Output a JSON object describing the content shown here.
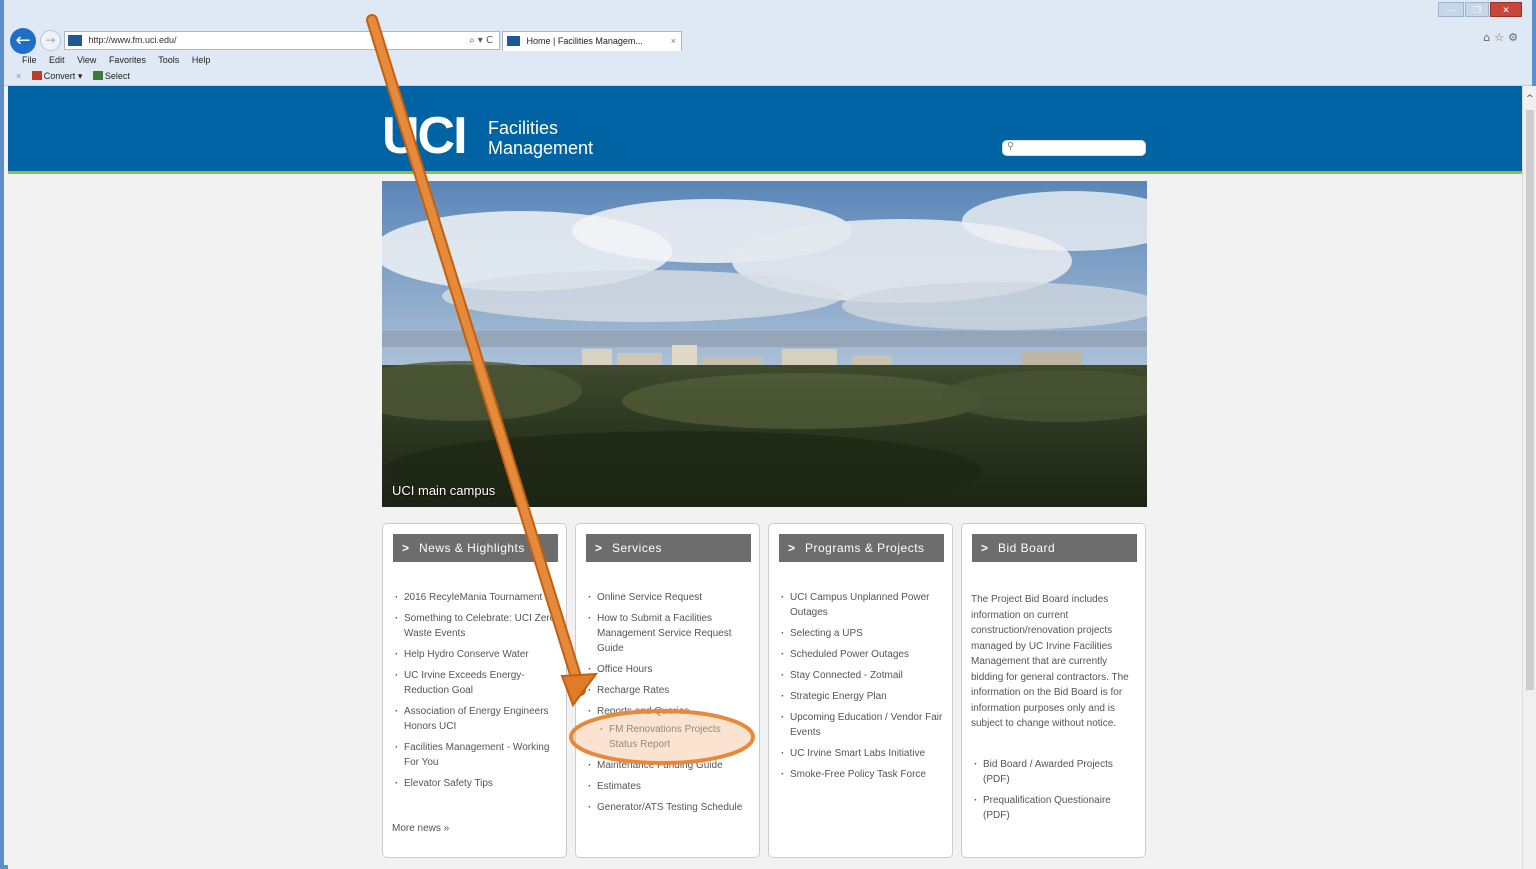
{
  "browser": {
    "url": "http://www.fm.uci.edu/",
    "url_controls": "⌕ ▾ C",
    "tab_title": "Home | Facilities Managem...",
    "tab_close": "×",
    "back_glyph": "←",
    "forward_glyph": "→",
    "menu": [
      "File",
      "Edit",
      "View",
      "Favorites",
      "Tools",
      "Help"
    ],
    "command_bar": {
      "close": "×",
      "convert": "Convert",
      "convert_arrow": "▾",
      "select": "Select"
    },
    "window_controls": {
      "minimize": "—",
      "maximize": "❐",
      "close": "✕"
    },
    "right_icons": "⌂☆⚙"
  },
  "site": {
    "logo_mark": "UCI",
    "logo_line1": "Facilities",
    "logo_line2": "Management",
    "search_glyph": "⚲",
    "hero_caption": "UCI main campus",
    "columns": [
      {
        "header": "News & Highlights",
        "items": [
          "2016 RecyleMania Tournament",
          "Something to Celebrate: UCI Zero Waste Events",
          "Help Hydro Conserve Water",
          "UC Irvine Exceeds Energy-Reduction Goal",
          "Association of Energy Engineers Honors UCI",
          "Facilities Management - Working For You",
          "Elevator Safety Tips"
        ],
        "more": "More news »"
      },
      {
        "header": "Services",
        "items": [
          "Online Service Request",
          "How to Submit a Facilities Management Service Request Guide",
          "Office Hours",
          "Recharge Rates",
          "Reports and Queries"
        ],
        "subitem": "FM Renovations Projects Status Report",
        "items_after": [
          "Maintenance Funding Guide",
          "Estimates",
          "Generator/ATS Testing Schedule"
        ]
      },
      {
        "header": "Programs & Projects",
        "items": [
          "UCI Campus Unplanned Power Outages",
          "Selecting a UPS",
          "Scheduled Power Outages",
          "Stay Connected - Zotmail",
          "Strategic Energy Plan",
          "Upcoming Education / Vendor Fair Events",
          "UC Irvine Smart Labs Initiative",
          "Smoke-Free Policy Task Force"
        ]
      },
      {
        "header": "Bid Board",
        "text": "The Project Bid Board includes information on current construction/renovation projects managed by UC Irvine Facilities Management that are currently bidding for general contractors. The information on the Bid Board is for information purposes only and is subject to change without notice.",
        "items": [
          "Bid Board / Awarded Projects (PDF)",
          "Prequalification Questionaire (PDF)"
        ]
      }
    ]
  },
  "colors": {
    "banner": "#0064a4",
    "accent_stripe": "#8dbc47",
    "column_header": "#6d6d6d",
    "annotation": "#e07b2a"
  }
}
